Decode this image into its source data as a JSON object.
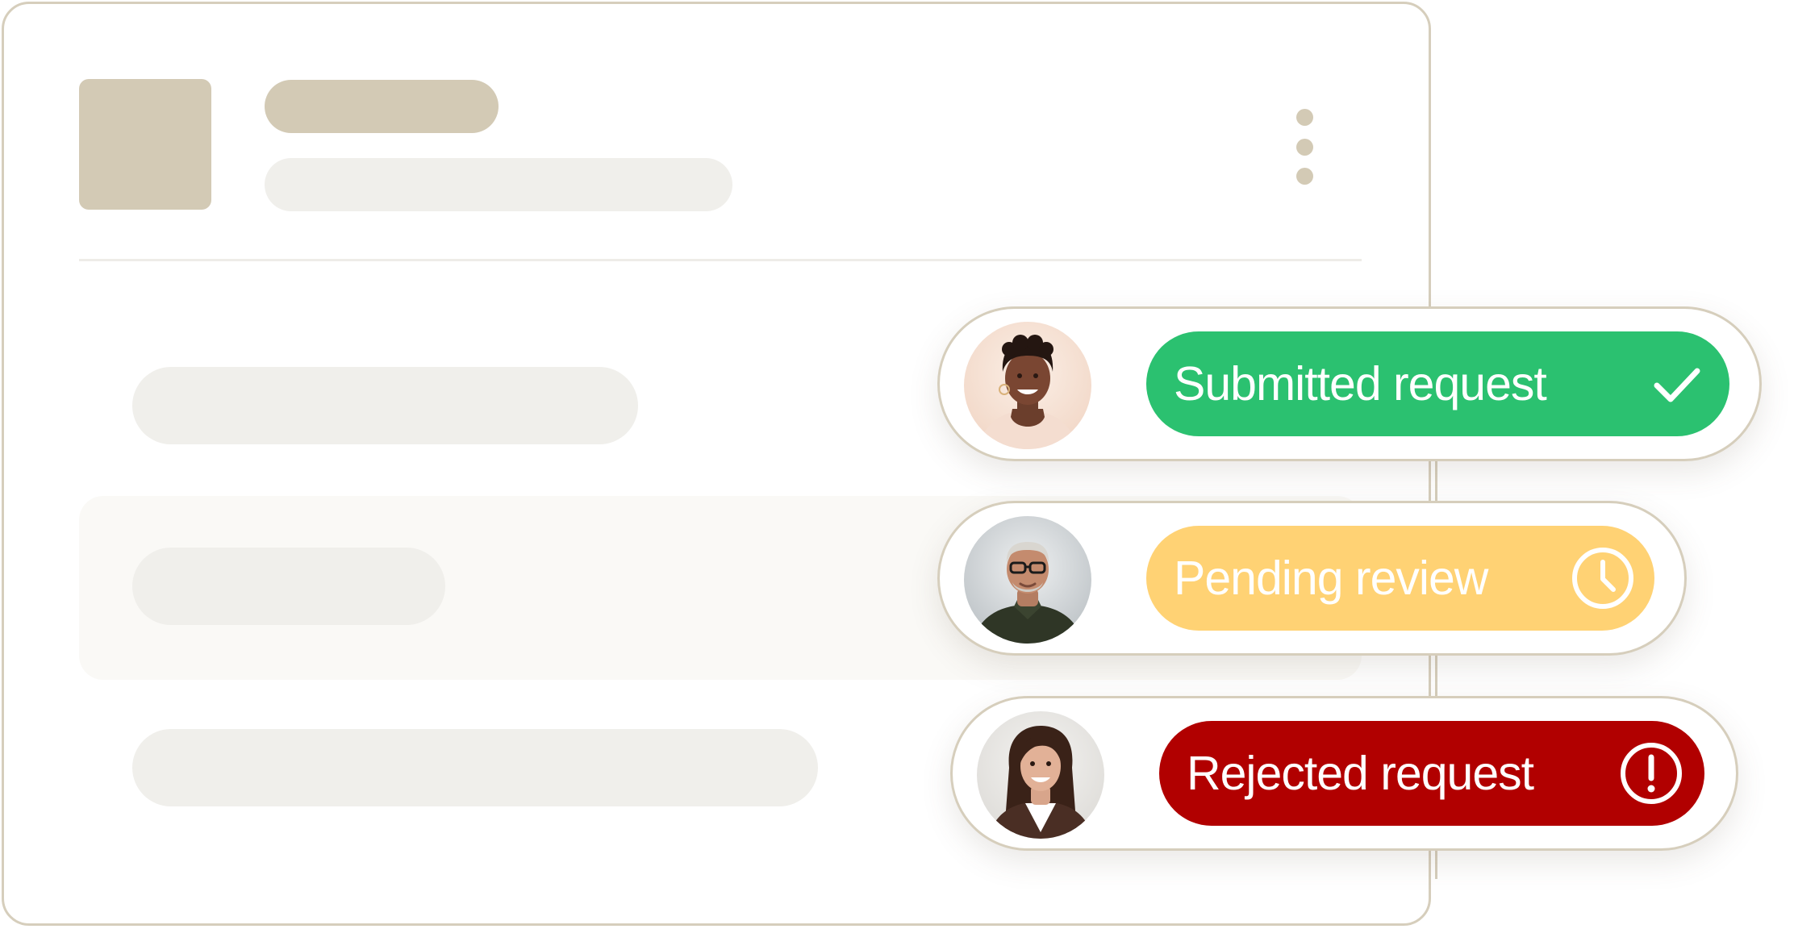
{
  "statuses": [
    {
      "label": "Submitted request",
      "icon": "check-icon",
      "avatar": "avatar-woman-short-curly-hair",
      "color": "#2bc170"
    },
    {
      "label": "Pending review",
      "icon": "clock-icon",
      "avatar": "avatar-man-glasses",
      "color": "#ffd274"
    },
    {
      "label": "Rejected request",
      "icon": "alert-circle-icon",
      "avatar": "avatar-woman-long-dark-hair",
      "color": "#b10000"
    }
  ],
  "colors": {
    "card_border": "#d6cebc",
    "placeholder_dark": "#d3cab5",
    "placeholder_light": "#f0efeb",
    "row_highlight": "#faf9f6"
  }
}
